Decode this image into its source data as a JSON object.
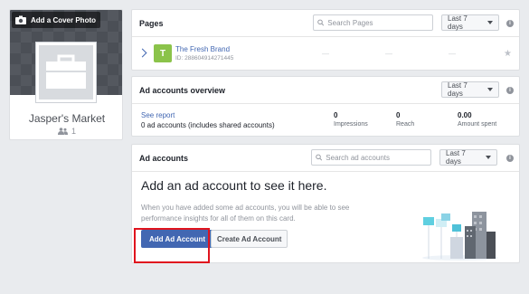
{
  "profile": {
    "cover_button_label": "Add a Cover Photo",
    "page_name": "Jasper's Market",
    "likes_count": "1"
  },
  "pages_card": {
    "title": "Pages",
    "search_placeholder": "Search Pages",
    "range": "Last 7 days",
    "info": "i",
    "page": {
      "initial": "T",
      "name": "The Fresh Brand",
      "id": "ID: 288604914271445",
      "dashes": [
        "—",
        "—",
        "—"
      ]
    },
    "star": "★"
  },
  "overview_card": {
    "title": "Ad accounts overview",
    "range": "Last 7 days",
    "info": "i",
    "see_report": "See report",
    "subtitle": "0 ad accounts (includes shared accounts)",
    "metrics": [
      {
        "value": "0",
        "label": "Impressions"
      },
      {
        "value": "0",
        "label": "Reach"
      },
      {
        "value": "0.00",
        "label": "Amount spent"
      }
    ]
  },
  "ad_accounts_card": {
    "title": "Ad accounts",
    "search_placeholder": "Search ad accounts",
    "range": "Last 7 days",
    "info": "i",
    "empty_title": "Add an ad account to see it here.",
    "empty_desc": "When you have added some ad accounts, you will be able to see performance insights for all of them on this card.",
    "add_button": "Add Ad Account",
    "create_button": "Create Ad Account"
  },
  "colors": {
    "brand_blue": "#4267b2",
    "highlight_red": "#e0141e",
    "page_thumb_green": "#8bc34a"
  }
}
